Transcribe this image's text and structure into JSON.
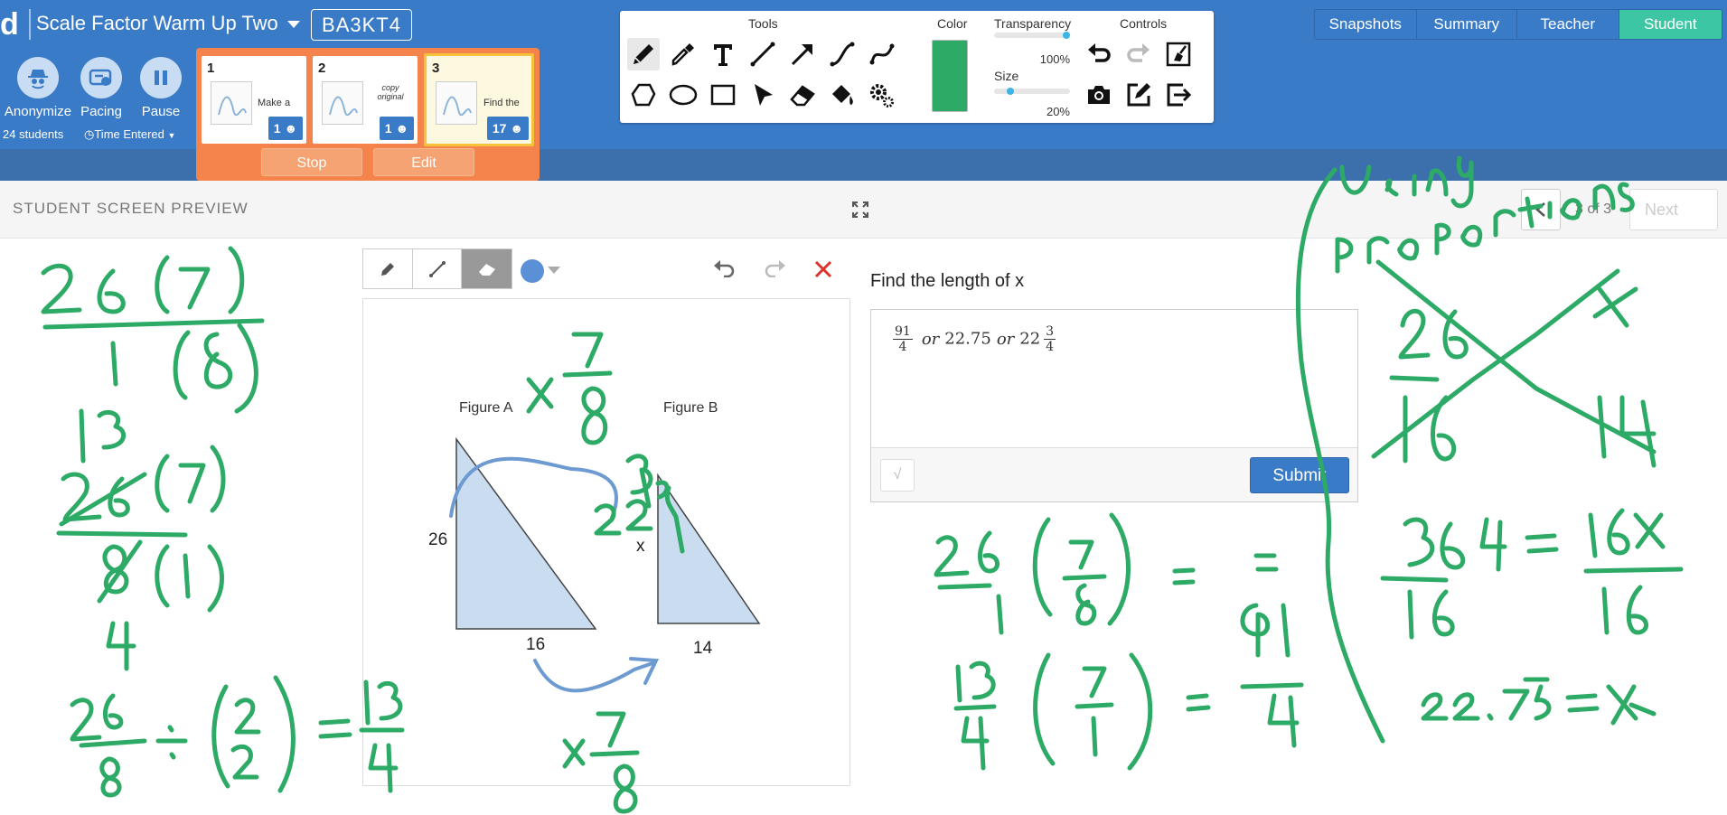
{
  "header": {
    "logo": "d",
    "activity_title": "Scale Factor Warm Up Two",
    "class_code": "BA3KT4",
    "nav_tabs": [
      "Snapshots",
      "Summary",
      "Teacher",
      "Student"
    ],
    "active_tab": "Student"
  },
  "controls": {
    "anonymize": "Anonymize",
    "pacing": "Pacing",
    "pause": "Pause",
    "student_count": "24 students",
    "sort_label": "Time Entered"
  },
  "cards": [
    {
      "number": "1",
      "text": "Make a",
      "badge": "1"
    },
    {
      "number": "2",
      "text": "copy original",
      "badge": "1"
    },
    {
      "number": "3",
      "text": "Find the",
      "badge": "17"
    }
  ],
  "card_buttons": {
    "stop": "Stop",
    "edit": "Edit"
  },
  "toolbar": {
    "tools_label": "Tools",
    "color_label": "Color",
    "transparency_label": "Transparency",
    "transparency_value": "100%",
    "size_label": "Size",
    "size_value": "20%",
    "controls_label": "Controls",
    "selected_color": "#2daa66"
  },
  "preview": {
    "title": "STUDENT SCREEN PREVIEW",
    "page_count": "3 of 3",
    "next_label": "Next"
  },
  "figure": {
    "label_a": "Figure A",
    "label_b": "Figure B",
    "side_a_vertical": "26",
    "side_a_base": "16",
    "side_b_vertical": "x",
    "side_b_base": "14"
  },
  "question": {
    "prompt": "Find the length of x",
    "answer_frac1_num": "91",
    "answer_frac1_den": "4",
    "answer_or1": "or",
    "answer_decimal": "22.75",
    "answer_or2": "or",
    "answer_whole": "22",
    "answer_frac2_num": "3",
    "answer_frac2_den": "4",
    "math_button": "√",
    "submit_label": "Submit"
  },
  "ink_color": "#2daa66",
  "ink_annotations": {
    "top_right_note": "using proportions",
    "work_left_1": "26(7) / 1(8)",
    "work_left_2": "13 26(7) / 8(1) 4",
    "work_left_3": "26/8 ÷ (2/2) = 13/4",
    "scale_top": "x 7/8",
    "scale_bottom": "x 7/8",
    "near_x": "22.75",
    "work_mid_1": "26/1 (7/8) =",
    "work_mid_2": "13/4 (7/1) = 91/4",
    "work_right_1": "26/16 = x/14",
    "work_right_2": "364 = 16x",
    "work_right_3": "16  16",
    "work_right_4": "22.75 = x"
  }
}
